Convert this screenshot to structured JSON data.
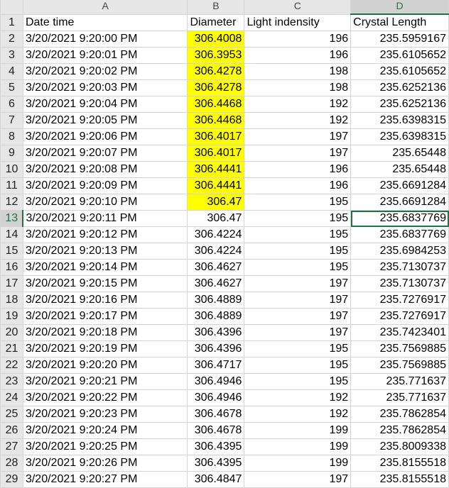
{
  "columns": [
    "A",
    "B",
    "C",
    "D"
  ],
  "selected_column": "D",
  "headers": {
    "row": "1",
    "date_time": "Date time",
    "diameter": "Diameter",
    "light": "Light indensity",
    "crystal": "Crystal Length"
  },
  "highlight_color": "#ffff00",
  "active_cell": "D13",
  "rows": [
    {
      "row": "2",
      "date": "3/20/2021 9:20:00 PM",
      "diameter": "306.4008",
      "light": "196",
      "crystal": "235.5959167",
      "highlight": true
    },
    {
      "row": "3",
      "date": "3/20/2021 9:20:01 PM",
      "diameter": "306.3953",
      "light": "196",
      "crystal": "235.6105652",
      "highlight": true
    },
    {
      "row": "4",
      "date": "3/20/2021 9:20:02 PM",
      "diameter": "306.4278",
      "light": "198",
      "crystal": "235.6105652",
      "highlight": true
    },
    {
      "row": "5",
      "date": "3/20/2021 9:20:03 PM",
      "diameter": "306.4278",
      "light": "198",
      "crystal": "235.6252136",
      "highlight": true
    },
    {
      "row": "6",
      "date": "3/20/2021 9:20:04 PM",
      "diameter": "306.4468",
      "light": "192",
      "crystal": "235.6252136",
      "highlight": true
    },
    {
      "row": "7",
      "date": "3/20/2021 9:20:05 PM",
      "diameter": "306.4468",
      "light": "192",
      "crystal": "235.6398315",
      "highlight": true
    },
    {
      "row": "8",
      "date": "3/20/2021 9:20:06 PM",
      "diameter": "306.4017",
      "light": "197",
      "crystal": "235.6398315",
      "highlight": true
    },
    {
      "row": "9",
      "date": "3/20/2021 9:20:07 PM",
      "diameter": "306.4017",
      "light": "197",
      "crystal": "235.65448",
      "highlight": true
    },
    {
      "row": "10",
      "date": "3/20/2021 9:20:08 PM",
      "diameter": "306.4441",
      "light": "196",
      "crystal": "235.65448",
      "highlight": true
    },
    {
      "row": "11",
      "date": "3/20/2021 9:20:09 PM",
      "diameter": "306.4441",
      "light": "196",
      "crystal": "235.6691284",
      "highlight": true
    },
    {
      "row": "12",
      "date": "3/20/2021 9:20:10 PM",
      "diameter": "306.47",
      "light": "195",
      "crystal": "235.6691284",
      "highlight": true
    },
    {
      "row": "13",
      "date": "3/20/2021 9:20:11 PM",
      "diameter": "306.47",
      "light": "195",
      "crystal": "235.6837769",
      "highlight": false,
      "active": true
    },
    {
      "row": "14",
      "date": "3/20/2021 9:20:12 PM",
      "diameter": "306.4224",
      "light": "195",
      "crystal": "235.6837769",
      "highlight": false
    },
    {
      "row": "15",
      "date": "3/20/2021 9:20:13 PM",
      "diameter": "306.4224",
      "light": "195",
      "crystal": "235.6984253",
      "highlight": false
    },
    {
      "row": "16",
      "date": "3/20/2021 9:20:14 PM",
      "diameter": "306.4627",
      "light": "195",
      "crystal": "235.7130737",
      "highlight": false
    },
    {
      "row": "17",
      "date": "3/20/2021 9:20:15 PM",
      "diameter": "306.4627",
      "light": "197",
      "crystal": "235.7130737",
      "highlight": false
    },
    {
      "row": "18",
      "date": "3/20/2021 9:20:16 PM",
      "diameter": "306.4889",
      "light": "197",
      "crystal": "235.7276917",
      "highlight": false
    },
    {
      "row": "19",
      "date": "3/20/2021 9:20:17 PM",
      "diameter": "306.4889",
      "light": "197",
      "crystal": "235.7276917",
      "highlight": false
    },
    {
      "row": "20",
      "date": "3/20/2021 9:20:18 PM",
      "diameter": "306.4396",
      "light": "197",
      "crystal": "235.7423401",
      "highlight": false
    },
    {
      "row": "21",
      "date": "3/20/2021 9:20:19 PM",
      "diameter": "306.4396",
      "light": "195",
      "crystal": "235.7569885",
      "highlight": false
    },
    {
      "row": "22",
      "date": "3/20/2021 9:20:20 PM",
      "diameter": "306.4717",
      "light": "195",
      "crystal": "235.7569885",
      "highlight": false
    },
    {
      "row": "23",
      "date": "3/20/2021 9:20:21 PM",
      "diameter": "306.4946",
      "light": "195",
      "crystal": "235.771637",
      "highlight": false
    },
    {
      "row": "24",
      "date": "3/20/2021 9:20:22 PM",
      "diameter": "306.4946",
      "light": "192",
      "crystal": "235.771637",
      "highlight": false
    },
    {
      "row": "25",
      "date": "3/20/2021 9:20:23 PM",
      "diameter": "306.4678",
      "light": "192",
      "crystal": "235.7862854",
      "highlight": false
    },
    {
      "row": "26",
      "date": "3/20/2021 9:20:24 PM",
      "diameter": "306.4678",
      "light": "199",
      "crystal": "235.7862854",
      "highlight": false
    },
    {
      "row": "27",
      "date": "3/20/2021 9:20:25 PM",
      "diameter": "306.4395",
      "light": "199",
      "crystal": "235.8009338",
      "highlight": false
    },
    {
      "row": "28",
      "date": "3/20/2021 9:20:26 PM",
      "diameter": "306.4395",
      "light": "199",
      "crystal": "235.8155518",
      "highlight": false
    },
    {
      "row": "29",
      "date": "3/20/2021 9:20:27 PM",
      "diameter": "306.4847",
      "light": "197",
      "crystal": "235.8155518",
      "highlight": false
    }
  ]
}
